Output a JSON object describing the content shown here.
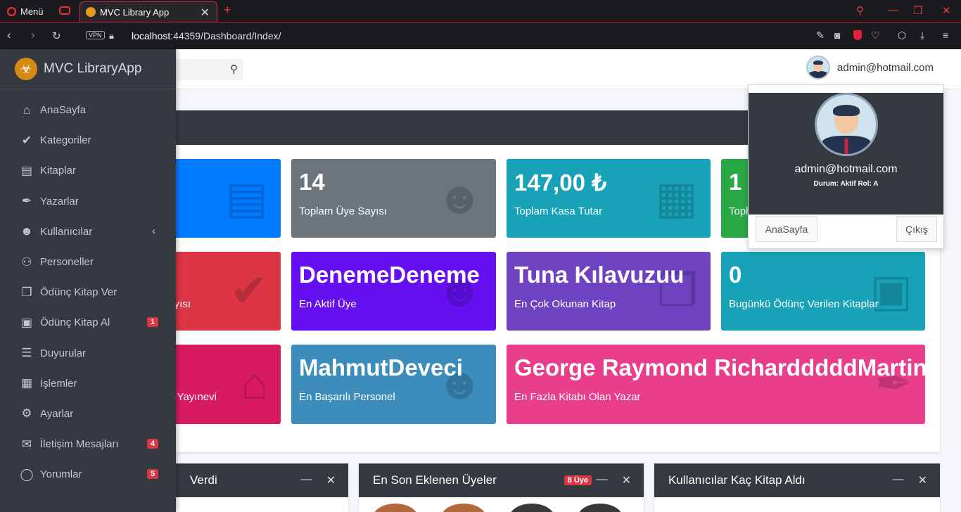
{
  "browser": {
    "menu_label": "Menü",
    "tab_title": "MVC Library App",
    "url_host": "localhost",
    "url_path": ":44359/Dashboard/Index/",
    "vpn": "VPN"
  },
  "sidebar": {
    "brand": "MVC LibraryApp",
    "items": [
      {
        "label": "AnaSayfa",
        "icon": "home-icon",
        "glyph": "⌂"
      },
      {
        "label": "Kategoriler",
        "icon": "check-double-icon",
        "glyph": "✔"
      },
      {
        "label": "Kitaplar",
        "icon": "book-icon",
        "glyph": "▤"
      },
      {
        "label": "Yazarlar",
        "icon": "pen-nib-icon",
        "glyph": "✒"
      },
      {
        "label": "Kullanıcılar",
        "icon": "users-icon",
        "glyph": "☻"
      },
      {
        "label": "Personeller",
        "icon": "people-icon",
        "glyph": "⚇"
      },
      {
        "label": "Ödünç Kitap Ver",
        "icon": "open-book-icon",
        "glyph": "❐"
      },
      {
        "label": "Ödünç Kitap Al",
        "icon": "book-reader-icon",
        "glyph": "▣",
        "badge": "1"
      },
      {
        "label": "Duyurular",
        "icon": "list-icon",
        "glyph": "☰"
      },
      {
        "label": "İşlemler",
        "icon": "building-icon",
        "glyph": "▦"
      },
      {
        "label": "Ayarlar",
        "icon": "gears-icon",
        "glyph": "⚙"
      },
      {
        "label": "İletişim Mesajları",
        "icon": "envelope-icon",
        "glyph": "✉",
        "badge": "4"
      },
      {
        "label": "Yorumlar",
        "icon": "comment-icon",
        "glyph": "◯",
        "badge": "5"
      }
    ]
  },
  "topnav": {
    "user_email": "admin@hotmail.com"
  },
  "stats": [
    {
      "value": "",
      "label": "",
      "color": "#007bff",
      "icon": "book-icon",
      "glyph": "▤"
    },
    {
      "value": "14",
      "label": "Toplam Üye Sayısı",
      "color": "#6c757d",
      "icon": "users-icon",
      "glyph": "☻"
    },
    {
      "value": "147,00 ₺",
      "label": "Toplam Kasa Tutar",
      "color": "#17a2b8",
      "icon": "cash-register-icon",
      "glyph": "▦"
    },
    {
      "value": "1",
      "label": "Topl",
      "color": "#28a745",
      "icon": "",
      "glyph": ""
    },
    {
      "value": "",
      "label": "yısı",
      "color": "#dc3545",
      "icon": "check-double-icon",
      "glyph": "✔"
    },
    {
      "value": "DenemeDeneme",
      "label": "En Aktif Üye",
      "color": "#6610f2",
      "icon": "users-icon",
      "glyph": "☻"
    },
    {
      "value": "Tuna Kılavuzuu",
      "label": "En Çok Okunan Kitap",
      "color": "#6f42c1",
      "icon": "open-book-icon",
      "glyph": "❐"
    },
    {
      "value": "0",
      "label": "Bugünkü Ödünç Verilen Kitaplar",
      "color": "#17a2b8",
      "icon": "address-book-icon",
      "glyph": "▣"
    },
    {
      "value": "",
      "label": "Yayınevi",
      "color": "#d81b60",
      "icon": "home-icon",
      "glyph": "⌂"
    },
    {
      "value": "MahmutDeveci",
      "label": "En Başarılı Personel",
      "color": "#3c8dbc",
      "icon": "graduate-icon",
      "glyph": "☻"
    },
    {
      "value": "George Raymond RichardddddMartin",
      "label": "En Fazla Kitabı Olan Yazar",
      "color": "#e83e8c",
      "icon": "pen-nib-icon",
      "glyph": "✒"
    }
  ],
  "bottom_cards": [
    {
      "title": "Verdi"
    },
    {
      "title": "En Son Eklenen Üyeler",
      "badge": "8 Üye"
    },
    {
      "title": "Kullanıcılar Kaç Kitap Aldı"
    }
  ],
  "dropdown": {
    "email": "admin@hotmail.com",
    "status": "Durum: Aktif Rol: A",
    "home_button": "AnaSayfa",
    "logout_button": "Çıkış"
  }
}
